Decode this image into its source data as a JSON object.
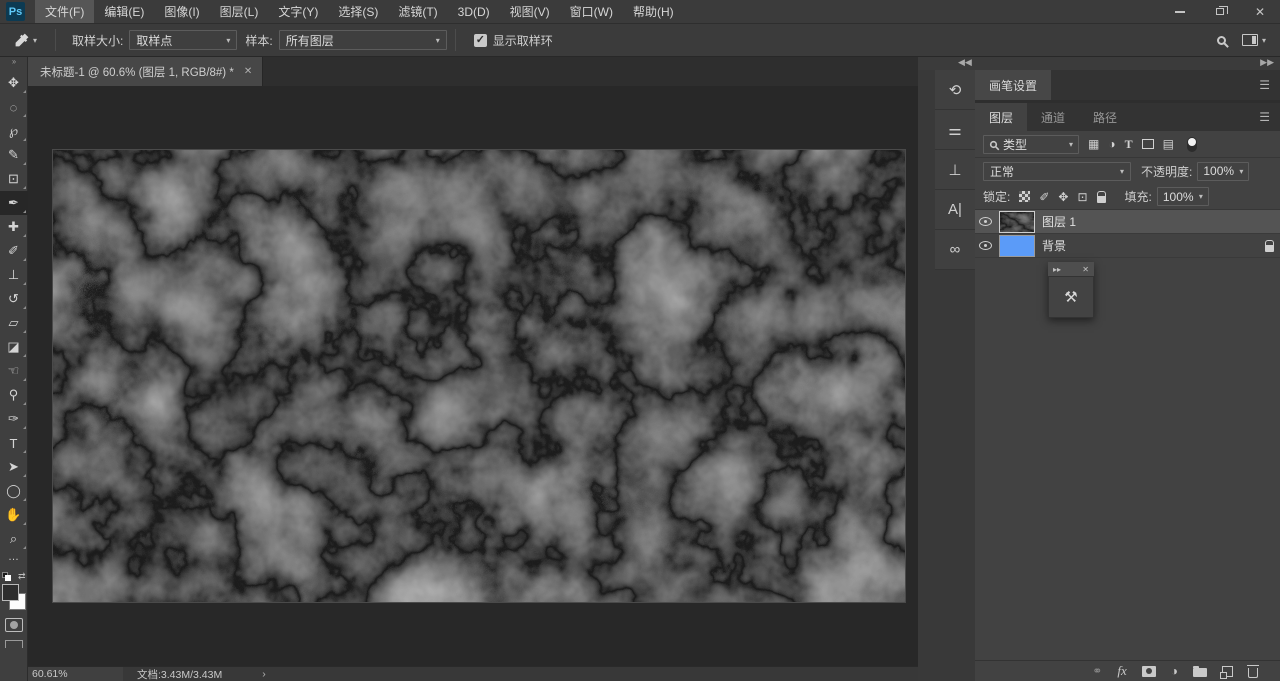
{
  "app": {
    "logo": "Ps",
    "window_controls": {
      "close": "✕"
    }
  },
  "menubar": {
    "items": [
      {
        "label": "文件(F)",
        "active": true
      },
      {
        "label": "编辑(E)"
      },
      {
        "label": "图像(I)"
      },
      {
        "label": "图层(L)"
      },
      {
        "label": "文字(Y)"
      },
      {
        "label": "选择(S)"
      },
      {
        "label": "滤镜(T)"
      },
      {
        "label": "3D(D)"
      },
      {
        "label": "视图(V)"
      },
      {
        "label": "窗口(W)"
      },
      {
        "label": "帮助(H)"
      }
    ]
  },
  "options_bar": {
    "tool_chevron": "▾",
    "sample_size_label": "取样大小:",
    "sample_size_value": "取样点",
    "sample_label": "样本:",
    "sample_value": "所有图层",
    "show_ring_label": "显示取样环",
    "show_ring_checked": true,
    "dropdown_chevron": "▾"
  },
  "document": {
    "tab_title": "未标题-1 @ 60.6% (图层 1, RGB/8#) *",
    "tab_close": "✕",
    "status_zoom": "60.61%",
    "status_doc": "文档:3.43M/3.43M",
    "status_chevron": "›"
  },
  "toolbar": {
    "collapse": "››",
    "tools": [
      {
        "name": "move-tool",
        "glyph": "✥"
      },
      {
        "name": "marquee-tool",
        "glyph": "◌"
      },
      {
        "name": "lasso-tool",
        "glyph": "℘"
      },
      {
        "name": "quick-selection-tool",
        "glyph": "✎"
      },
      {
        "name": "crop-tool",
        "glyph": "⊡"
      },
      {
        "name": "eyedropper-tool",
        "glyph": "✒",
        "selected": true
      },
      {
        "name": "spot-healing-brush-tool",
        "glyph": "✚"
      },
      {
        "name": "brush-tool",
        "glyph": "✐"
      },
      {
        "name": "clone-stamp-tool",
        "glyph": "⊥"
      },
      {
        "name": "history-brush-tool",
        "glyph": "↺"
      },
      {
        "name": "eraser-tool",
        "glyph": "▱"
      },
      {
        "name": "gradient-tool",
        "glyph": "◪"
      },
      {
        "name": "smudge-tool",
        "glyph": "☜"
      },
      {
        "name": "dodge-tool",
        "glyph": "⚲"
      },
      {
        "name": "pen-tool",
        "glyph": "✑"
      },
      {
        "name": "type-tool",
        "glyph": "T"
      },
      {
        "name": "path-selection-tool",
        "glyph": "➤"
      },
      {
        "name": "shape-tool",
        "glyph": "◯"
      },
      {
        "name": "hand-tool",
        "glyph": "✋"
      },
      {
        "name": "zoom-tool",
        "glyph": "⌕"
      }
    ],
    "more": "…",
    "swap_arrows": "⇄"
  },
  "dock": {
    "collapse_icon_strip": "◀◀",
    "collapse_panels": "▶▶",
    "icon_strip": [
      {
        "name": "history-panel-icon",
        "glyph": "⟲"
      },
      {
        "name": "brush-settings-panel-icon",
        "glyph": "⚌"
      },
      {
        "name": "clone-source-panel-icon",
        "glyph": "⊥"
      },
      {
        "name": "character-panel-icon",
        "glyph": "A|"
      },
      {
        "name": "cc-libraries-panel-icon",
        "glyph": "∞"
      }
    ],
    "brush_panel": {
      "tab": "画笔设置",
      "menu": "☰"
    },
    "layers_panel": {
      "tabs": [
        {
          "label": "图层",
          "active": true
        },
        {
          "label": "通道"
        },
        {
          "label": "路径"
        }
      ],
      "menu": "☰",
      "filter": {
        "search_value": "类型",
        "type_icon_label": "T"
      },
      "blend_mode": "正常",
      "opacity_label": "不透明度:",
      "opacity_value": "100%",
      "lock_label": "锁定:",
      "lock_brush": "✐",
      "lock_move": "✥",
      "lock_artboard": "⊡",
      "fill_label": "填充:",
      "fill_value": "100%",
      "layers": {
        "layer1": {
          "name": "图层 1",
          "selected": true
        },
        "background": {
          "name": "背景",
          "locked": true,
          "thumb_color": "#5b9bf8"
        }
      },
      "fx_label": "fx",
      "link_glyph": "⚭",
      "adjustment_glyph": "◑"
    },
    "floating_panel": {
      "collapse": "▸▸",
      "close": "✕",
      "icon": "⚒"
    }
  }
}
